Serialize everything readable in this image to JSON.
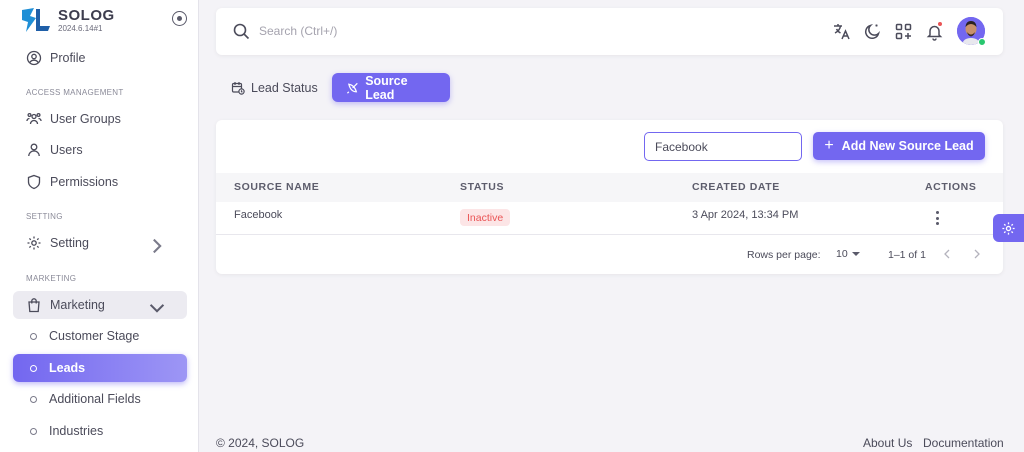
{
  "brand": {
    "name": "SOLOG",
    "version": "2024.6.14#1",
    "logo_text": "SL"
  },
  "sidebar": {
    "profile": "Profile",
    "sections": [
      "ACCESS MANAGEMENT",
      "SETTING",
      "MARKETING"
    ],
    "access": [
      "User Groups",
      "Users",
      "Permissions"
    ],
    "setting": "Setting",
    "marketing": "Marketing",
    "marketing_items": [
      "Customer Stage",
      "Leads",
      "Additional Fields",
      "Industries"
    ]
  },
  "navbar": {
    "search_placeholder": "Search (Ctrl+/)",
    "icons": [
      "translate-icon",
      "moon-icon",
      "apps-grid-icon",
      "bell-icon"
    ]
  },
  "tabs": [
    {
      "label": "Lead Status",
      "active": false
    },
    {
      "label": "Source Lead",
      "active": true
    }
  ],
  "toolbar": {
    "filter_value": "Facebook",
    "add_label": "Add New Source Lead"
  },
  "table": {
    "columns": [
      "SOURCE NAME",
      "STATUS",
      "CREATED DATE",
      "ACTIONS"
    ],
    "rows": [
      {
        "source_name": "Facebook",
        "status": "Inactive",
        "created_date": "3 Apr 2024, 13:34 PM"
      }
    ]
  },
  "pagination": {
    "rows_per_page_label": "Rows per page:",
    "rows_per_page": "10",
    "range": "1–1 of 1"
  },
  "footer": {
    "copyright": "© 2024, SOLOG",
    "links": [
      "About Us",
      "Documentation"
    ]
  },
  "colors": {
    "primary": "#7367f0",
    "danger": "#ea5455",
    "success": "#28c76f"
  }
}
